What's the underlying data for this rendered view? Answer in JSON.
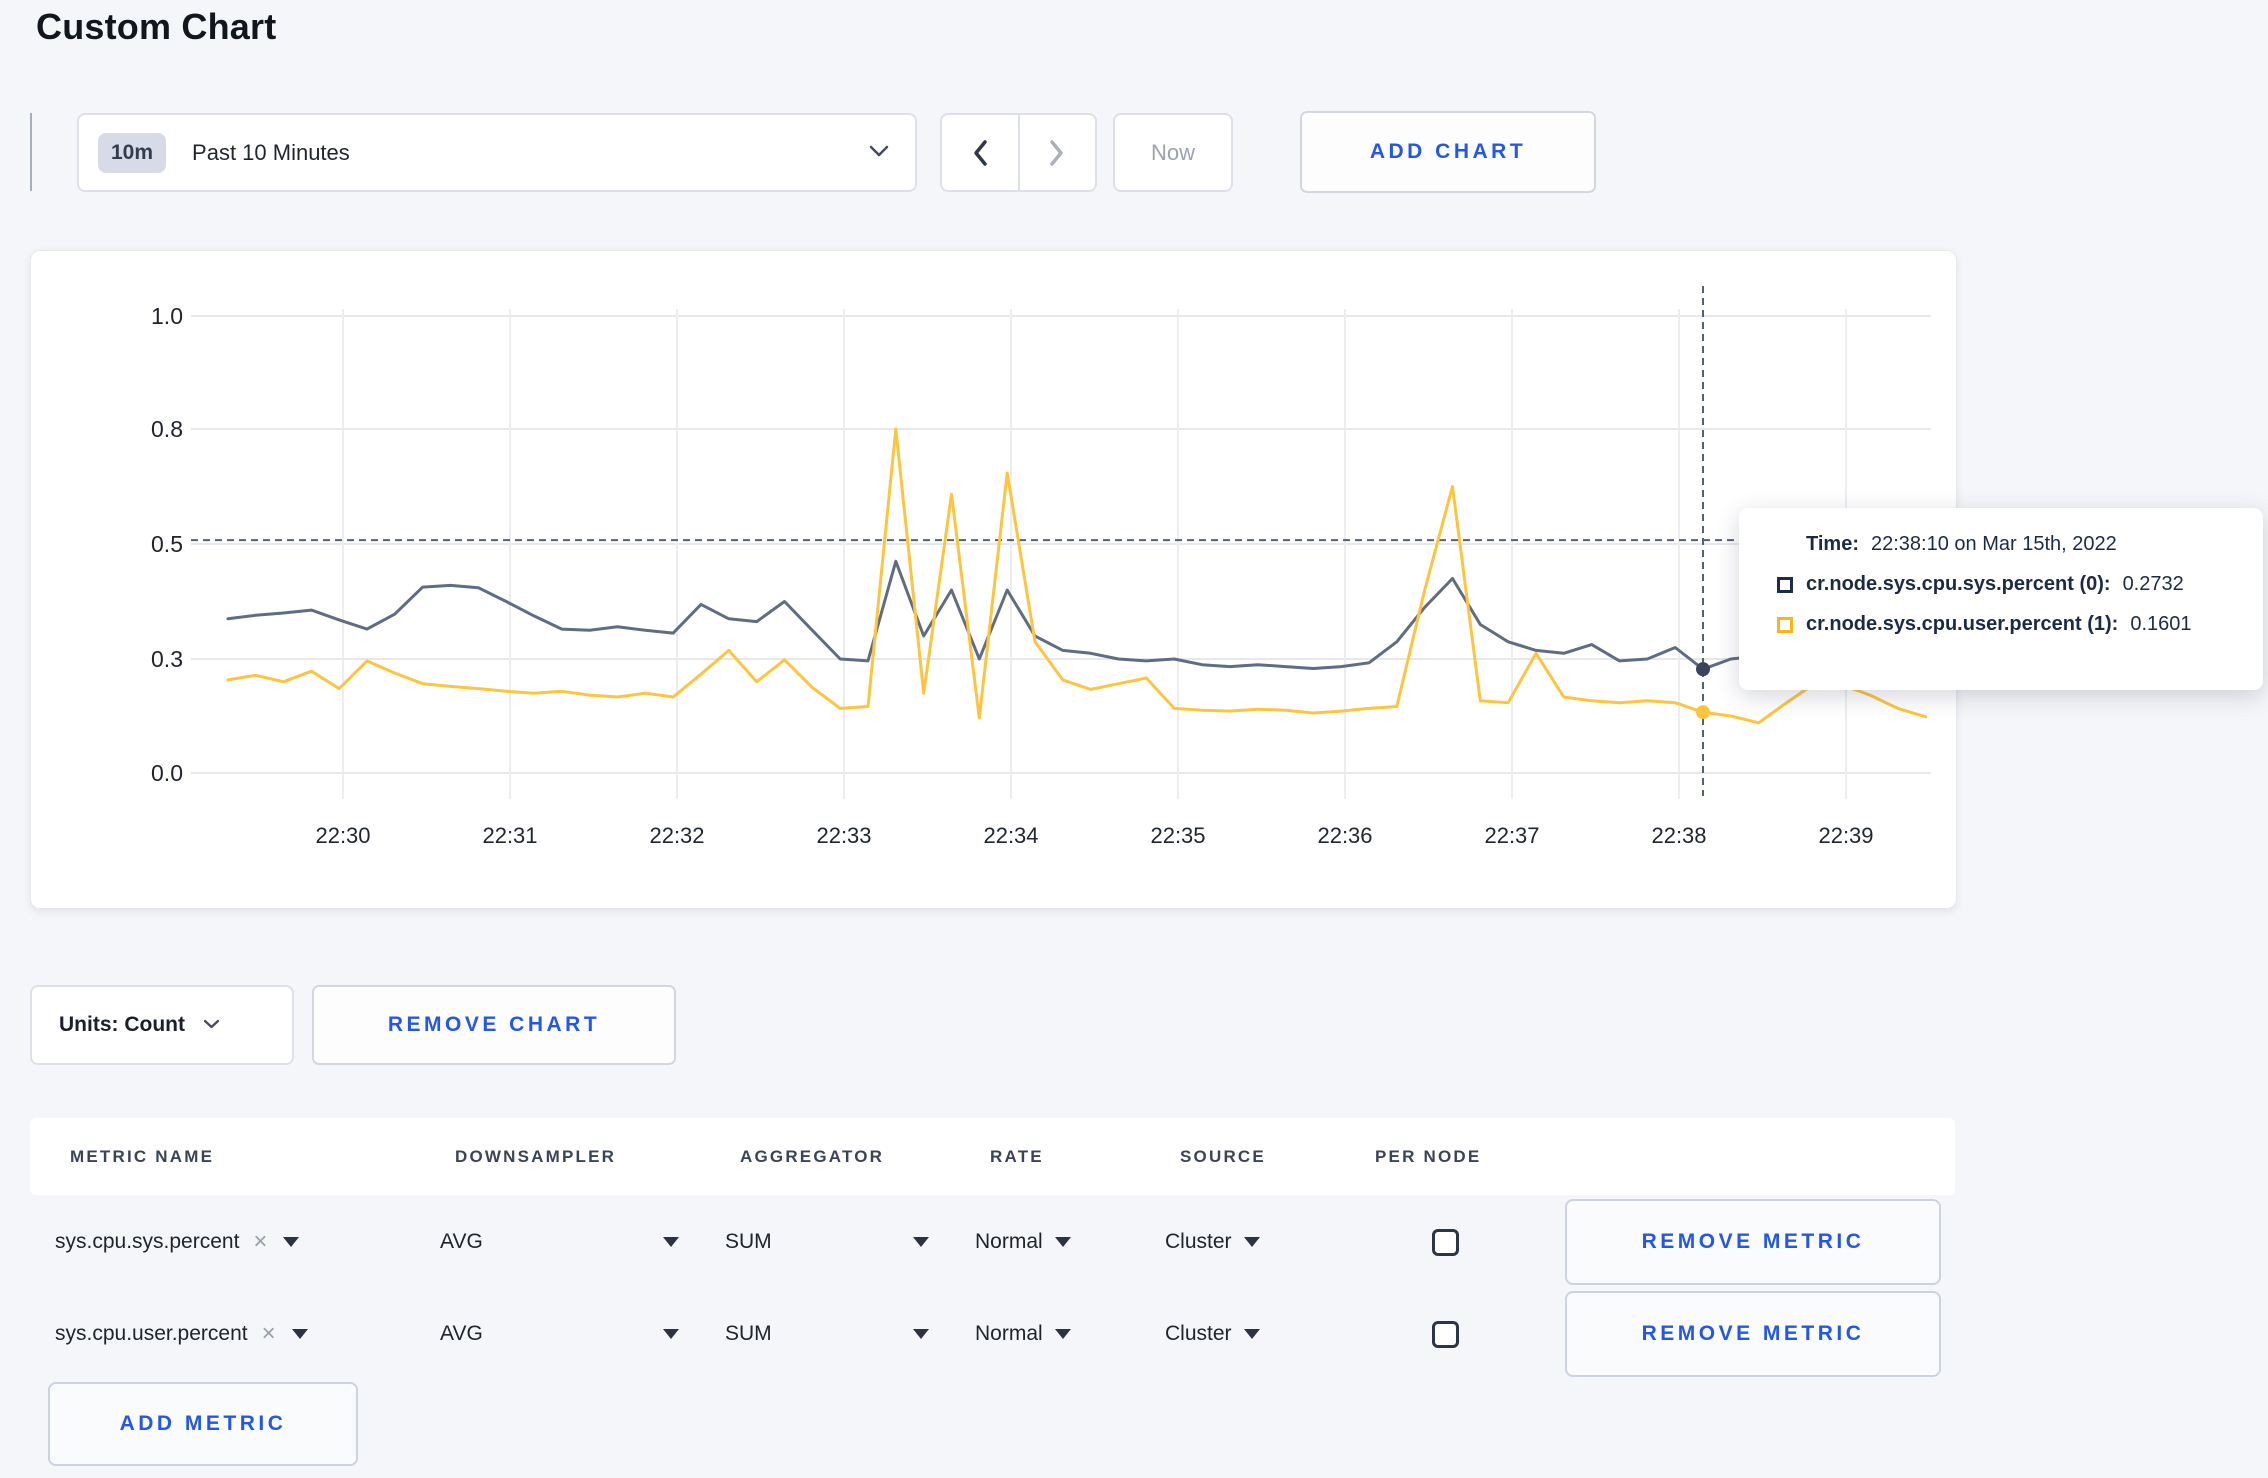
{
  "page": {
    "title": "Custom Chart",
    "background": "#f5f6f9",
    "accent_blue": "#2458e4"
  },
  "toolbar": {
    "time_range_badge": "10m",
    "time_range_label": "Past 10 Minutes",
    "now_label": "Now",
    "add_chart_label": "ADD CHART"
  },
  "chart_data": {
    "type": "line",
    "title": "",
    "xlabel": "",
    "ylabel": "",
    "x_start": "22:29:20",
    "x_step_seconds": 10,
    "x_tick_labels": [
      "22:30",
      "22:31",
      "22:32",
      "22:33",
      "22:34",
      "22:35",
      "22:36",
      "22:37",
      "22:38",
      "22:39"
    ],
    "y_ticks": [
      {
        "value": 0.0,
        "label": "0.0"
      },
      {
        "value": 0.3,
        "label": "0.3"
      },
      {
        "value": 0.5,
        "label": "0.5"
      },
      {
        "value": 0.8,
        "label": "0.8"
      },
      {
        "value": 1.0,
        "label": "1.0"
      }
    ],
    "grid": true,
    "legend_position": "none",
    "series": [
      {
        "name": "cr.node.sys.cpu.sys.percent",
        "color": "#5f6c83",
        "values": [
          0.37,
          0.376,
          0.38,
          0.385,
          0.368,
          0.352,
          0.378,
          0.425,
          0.428,
          0.424,
          0.4,
          0.375,
          0.352,
          0.35,
          0.356,
          0.35,
          0.345,
          0.395,
          0.37,
          0.365,
          0.4,
          0.35,
          0.3,
          0.295,
          0.47,
          0.34,
          0.42,
          0.3,
          0.42,
          0.34,
          0.315,
          0.31,
          0.3,
          0.295,
          0.3,
          0.285,
          0.28,
          0.285,
          0.28,
          0.275,
          0.28,
          0.29,
          0.33,
          0.39,
          0.44,
          0.36,
          0.33,
          0.315,
          0.31,
          0.325,
          0.295,
          0.3,
          0.32,
          0.2732,
          0.3,
          0.305,
          0.3,
          0.295,
          0.3,
          0.305,
          0.3,
          0.3
        ]
      },
      {
        "name": "cr.node.sys.cpu.user.percent",
        "color": "#fdc53f",
        "values": [
          0.245,
          0.257,
          0.24,
          0.268,
          0.222,
          0.295,
          0.263,
          0.235,
          0.228,
          0.222,
          0.215,
          0.21,
          0.215,
          0.205,
          0.2,
          0.21,
          0.2,
          0.26,
          0.315,
          0.24,
          0.298,
          0.225,
          0.17,
          0.175,
          0.8,
          0.21,
          0.63,
          0.145,
          0.685,
          0.33,
          0.245,
          0.22,
          0.235,
          0.25,
          0.17,
          0.165,
          0.163,
          0.168,
          0.165,
          0.158,
          0.163,
          0.17,
          0.175,
          0.42,
          0.65,
          0.19,
          0.185,
          0.31,
          0.2,
          0.19,
          0.185,
          0.19,
          0.185,
          0.1601,
          0.15,
          0.132,
          0.185,
          0.235,
          0.232,
          0.205,
          0.17,
          0.148
        ]
      }
    ],
    "crosshair": {
      "index": 53,
      "time_label": "22:38:10",
      "hover_value": 0.51,
      "sys_value": 0.2732,
      "user_value": 0.1601
    }
  },
  "tooltip": {
    "time_label": "Time:",
    "time_value": "22:38:10 on Mar 15th, 2022",
    "rows": [
      {
        "label": "cr.node.sys.cpu.sys.percent (0):",
        "value": "0.2732",
        "swatch": "#1d2c49"
      },
      {
        "label": "cr.node.sys.cpu.user.percent (1):",
        "value": "0.1601",
        "swatch": "#fdb515"
      }
    ]
  },
  "units": {
    "label": "Units: Count"
  },
  "remove_chart_label": "REMOVE CHART",
  "metrics_table": {
    "headers": [
      "METRIC NAME",
      "DOWNSAMPLER",
      "AGGREGATOR",
      "RATE",
      "SOURCE",
      "PER NODE"
    ],
    "rows": [
      {
        "metric": "sys.cpu.sys.percent",
        "downsampler": "AVG",
        "aggregator": "SUM",
        "rate": "Normal",
        "source": "Cluster",
        "per_node_checked": false,
        "remove_label": "REMOVE METRIC"
      },
      {
        "metric": "sys.cpu.user.percent",
        "downsampler": "AVG",
        "aggregator": "SUM",
        "rate": "Normal",
        "source": "Cluster",
        "per_node_checked": false,
        "remove_label": "REMOVE METRIC"
      }
    ],
    "add_metric_label": "ADD METRIC"
  }
}
